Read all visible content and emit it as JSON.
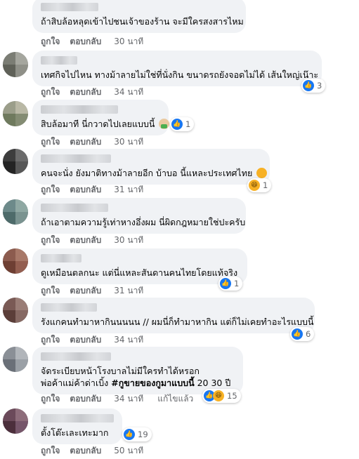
{
  "actions": {
    "like": "ถูกใจ",
    "reply": "ตอบกลับ",
    "edited": "แก้ไขแล้ว"
  },
  "colors": {
    "like_blue": "#1877f2",
    "meta_grey": "#65676b",
    "bubble_bg": "#f0f2f5",
    "haha_yellow": "#f7b125"
  },
  "comments": [
    {
      "text": "ถ้าสิบล้อหลุดเข้าไปชนเจ้าของร้าน จะมีใครสงสารไหม",
      "time": "30 นาที"
    },
    {
      "text": "เทศกิจไปไหน ทางม้าลายไม่ใช่ที่นั่งกิน ขนาดรถยังจอดไม่ได้ เส้นใหญ่เน๊าะ",
      "time": "34 นาที",
      "reaction": {
        "icon": "like-icon",
        "count": "3"
      }
    },
    {
      "text": "สิบล้อมาที นี่กวาดไปเลยแบบนี้",
      "emoji": "person-facepalm-emoji",
      "time": "30 นาที",
      "reaction": {
        "icon": "like-icon",
        "count": "1"
      }
    },
    {
      "text": "คนจะนั่ง ยังมาติทางม้าลายอีก บ้าบอ นี้แหละประเทศไทย",
      "emoji": "persevering-face-emoji",
      "time": "31 นาที",
      "reaction": {
        "icon": "haha-icon",
        "count": "1"
      }
    },
    {
      "text": "ถ้าเอาตามความรู้เท่าหางอึ่งผม นี่ผิดกฎหมายใช่ปะครับ",
      "time": "30 นาที"
    },
    {
      "text": "ดูเหมือนตลกนะ แต่นี่แหละสันดานคนไทยโดยแท้จริง",
      "time": "31 นาที",
      "reaction": {
        "icon": "like-icon",
        "count": "1"
      }
    },
    {
      "text": "รังแกคนทำมาหากินนนนน // ผมนี่ก็ทำมาหากิน แต่ก็ไม่เคยทำอะไรแบบนี้",
      "time": "34 นาที",
      "reaction": {
        "icon": "like-icon",
        "count": "6"
      }
    },
    {
      "text_line1": "จัดระเบียบหน้าโรงบาลไม่มีใครทำได้หรอก",
      "text_line2_normal": "พ่อค้าแม่ค้าด่าเบิ้ง ",
      "text_line2_bold": "#กูขายของกูมาแบบนี้",
      "text_line2_end": " 20 30 ปี",
      "time": "34 นาที",
      "edited": true,
      "reaction": {
        "icon": "like-haha-icons",
        "count": "15"
      }
    },
    {
      "text": "ตั้งโต๊ะเละเทะมาก",
      "time": "50 นาที",
      "reaction": {
        "icon": "like-icon",
        "count": "19"
      }
    }
  ]
}
